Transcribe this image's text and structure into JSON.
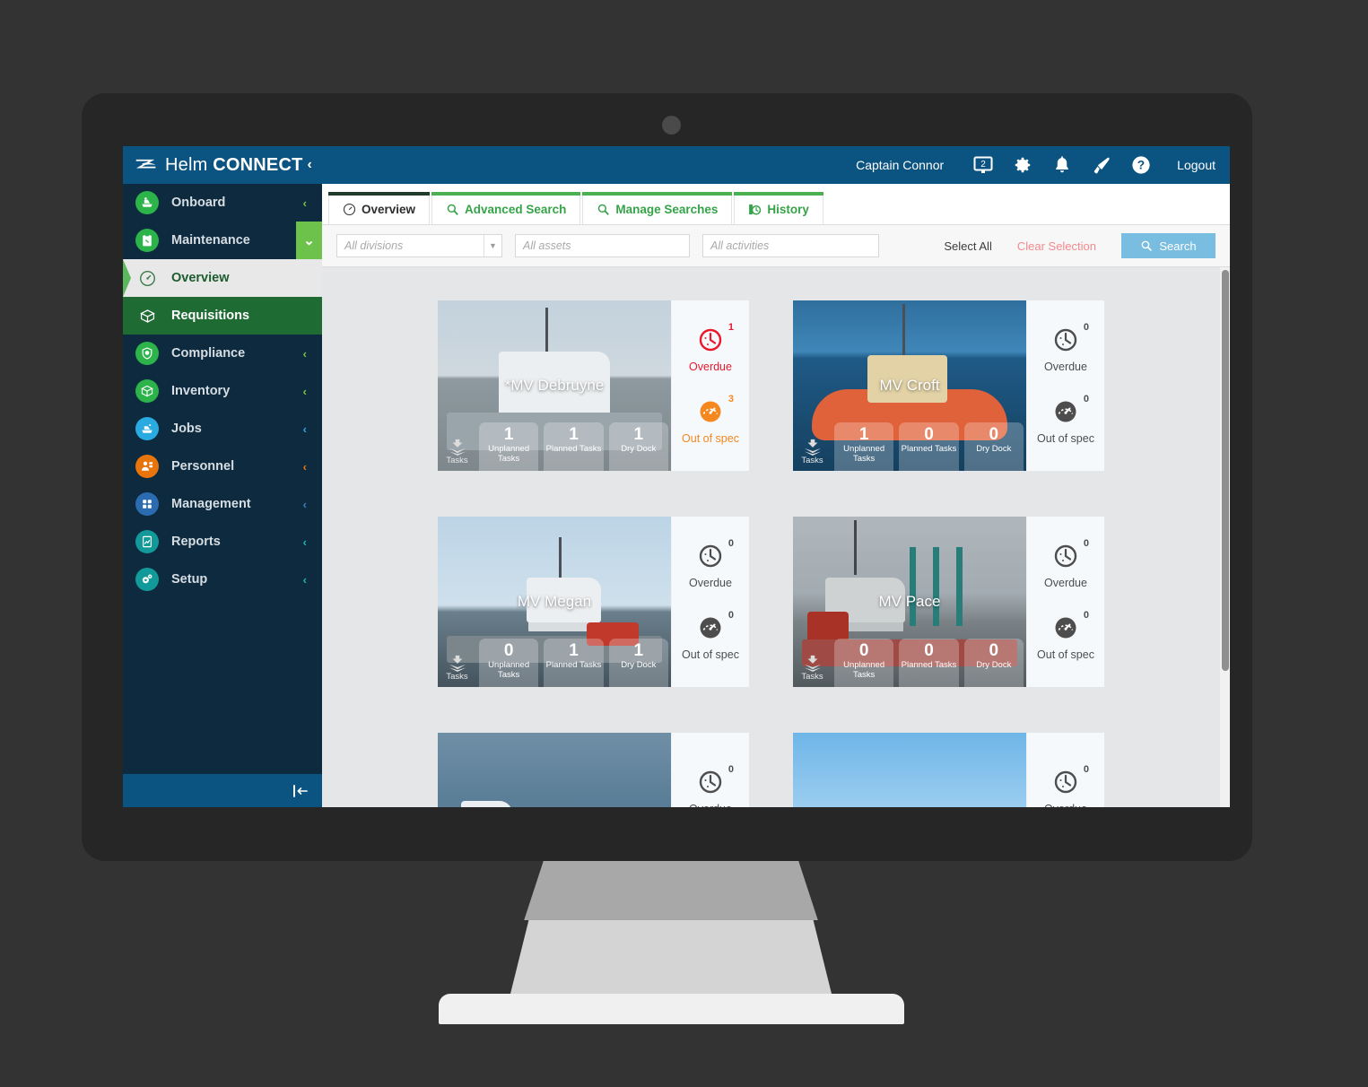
{
  "app": {
    "brand_thin": "Helm ",
    "brand_bold": "CONNECT",
    "brand_caret": "‹"
  },
  "header": {
    "user_name": "Captain Connor",
    "logout_label": "Logout",
    "icons": [
      {
        "name": "screen-share-icon"
      },
      {
        "name": "gear-icon"
      },
      {
        "name": "bell-icon"
      },
      {
        "name": "megaphone-icon"
      },
      {
        "name": "help-icon"
      }
    ]
  },
  "sidebar": {
    "items": [
      {
        "label": "Onboard",
        "icon": "onboard-icon",
        "color": "#2cb34a",
        "caret": "‹",
        "caret_color": "#7dc143",
        "state": "normal"
      },
      {
        "label": "Maintenance",
        "icon": "maintenance-icon",
        "color": "#2cb34a",
        "caret": "⌄",
        "caret_color": "#ffffff",
        "state": "expanded"
      },
      {
        "label": "Overview",
        "icon": "gauge-icon",
        "color": "#1c5c2e",
        "caret": "",
        "caret_color": "",
        "state": "selected-light"
      },
      {
        "label": "Requisitions",
        "icon": "box-icon",
        "color": "#ffffff",
        "caret": "",
        "caret_color": "",
        "state": "selected-green"
      },
      {
        "label": "Compliance",
        "icon": "shield-icon",
        "color": "#2cb34a",
        "caret": "‹",
        "caret_color": "#7dc143",
        "state": "normal"
      },
      {
        "label": "Inventory",
        "icon": "inventory-box-icon",
        "color": "#2cb34a",
        "caret": "‹",
        "caret_color": "#7dc143",
        "state": "normal"
      },
      {
        "label": "Jobs",
        "icon": "jobs-boat-icon",
        "color": "#29abe2",
        "caret": "‹",
        "caret_color": "#29abe2",
        "state": "normal"
      },
      {
        "label": "Personnel",
        "icon": "personnel-icon",
        "color": "#e8740c",
        "caret": "‹",
        "caret_color": "#e8740c",
        "state": "normal"
      },
      {
        "label": "Management",
        "icon": "management-grid-icon",
        "color": "#2b6cb0",
        "caret": "‹",
        "caret_color": "#3b82c4",
        "state": "normal"
      },
      {
        "label": "Reports",
        "icon": "reports-icon",
        "color": "#129a9a",
        "caret": "‹",
        "caret_color": "#1bb3b3",
        "state": "normal"
      },
      {
        "label": "Setup",
        "icon": "setup-gears-icon",
        "color": "#129a9a",
        "caret": "‹",
        "caret_color": "#1bb3b3",
        "state": "normal"
      }
    ],
    "collapse_icon": "collapse-sidebar-icon"
  },
  "tabs": [
    {
      "label": "Overview",
      "icon": "gauge-icon",
      "active": true
    },
    {
      "label": "Advanced Search",
      "icon": "search-icon",
      "active": false
    },
    {
      "label": "Manage Searches",
      "icon": "search-icon",
      "active": false
    },
    {
      "label": "History",
      "icon": "history-clock-icon",
      "active": false
    }
  ],
  "filters": {
    "divisions_placeholder": "All divisions",
    "assets_placeholder": "All assets",
    "activities_placeholder": "All activities",
    "select_all_label": "Select All",
    "clear_selection_label": "Clear Selection",
    "search_label": "Search"
  },
  "cards_common": {
    "tasks_label": "Tasks",
    "unplanned_label": "Unplanned Tasks",
    "planned_label": "Planned Tasks",
    "drydock_label": "Dry Dock",
    "overdue_label": "Overdue",
    "outofspec_label": "Out of spec"
  },
  "colors": {
    "brand_blue": "#0b5380",
    "sidebar_dark": "#0d2a3e",
    "green": "#4caf50",
    "overdue_red": "#e8182d",
    "outofspec_orange": "#f5871f",
    "neutral_gray": "#4d4d4d",
    "search_button": "#79bde0",
    "clear_selection_pink": "#f2898f"
  },
  "cards": [
    {
      "name": "*MV Debruyne",
      "photo": "ph-debruyne",
      "unplanned": "1",
      "planned": "1",
      "drydock": "1",
      "overdue_count": "1",
      "overdue_color": "#e8182d",
      "outofspec_count": "3",
      "outofspec_color": "#f5871f"
    },
    {
      "name": "MV Croft",
      "photo": "ph-croft",
      "unplanned": "1",
      "planned": "0",
      "drydock": "0",
      "overdue_count": "0",
      "overdue_color": "#4d4d4d",
      "outofspec_count": "0",
      "outofspec_color": "#4d4d4d"
    },
    {
      "name": "MV Megan",
      "photo": "ph-megan",
      "unplanned": "0",
      "planned": "1",
      "drydock": "1",
      "overdue_count": "0",
      "overdue_color": "#4d4d4d",
      "outofspec_count": "0",
      "outofspec_color": "#4d4d4d"
    },
    {
      "name": "MV Pace",
      "photo": "ph-pace",
      "unplanned": "0",
      "planned": "0",
      "drydock": "0",
      "overdue_count": "0",
      "overdue_color": "#4d4d4d",
      "outofspec_count": "0",
      "outofspec_color": "#4d4d4d"
    },
    {
      "name": "",
      "photo": "ph-sea",
      "unplanned": "",
      "planned": "",
      "drydock": "",
      "overdue_count": "0",
      "overdue_color": "#4d4d4d",
      "outofspec_count": "",
      "outofspec_color": "#4d4d4d"
    },
    {
      "name": "",
      "photo": "ph-barn",
      "unplanned": "",
      "planned": "",
      "drydock": "",
      "overdue_count": "0",
      "overdue_color": "#4d4d4d",
      "outofspec_count": "",
      "outofspec_color": "#4d4d4d"
    }
  ]
}
